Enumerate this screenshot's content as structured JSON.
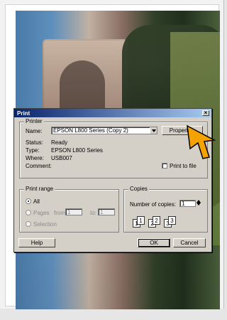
{
  "dialog": {
    "title": "Print",
    "close_symbol": "×",
    "printer_group": {
      "title": "Printer",
      "name_label": "Name:",
      "name_value": "EPSON L800 Series (Copy 2)",
      "properties_label": "Properties",
      "status_label": "Status:",
      "status_value": "Ready",
      "type_label": "Type:",
      "type_value": "EPSON L800 Series",
      "where_label": "Where:",
      "where_value": "USB007",
      "comment_label": "Comment:",
      "print_to_file_label": "Print to file"
    },
    "print_range_group": {
      "title": "Print range",
      "all_label": "All",
      "pages_label": "Pages",
      "from_label": "from:",
      "from_value": "1",
      "to_label": "to:",
      "to_value": "1",
      "selection_label": "Selection"
    },
    "copies_group": {
      "title": "Copies",
      "number_label": "Number of copies:",
      "number_value": "1"
    },
    "buttons": {
      "help": "Help",
      "ok": "OK",
      "cancel": "Cancel"
    }
  },
  "icons": {
    "close": "close-icon",
    "dropdown": "chevron-down-icon",
    "spinner_up": "chevron-up-icon",
    "spinner_down": "chevron-down-icon",
    "cursor": "cursor-arrow-icon"
  },
  "colors": {
    "dialog_bg": "#d4d0c8",
    "titlebar_start": "#0a246a",
    "titlebar_end": "#a6caf0",
    "cursor_fill": "#f5a200"
  }
}
